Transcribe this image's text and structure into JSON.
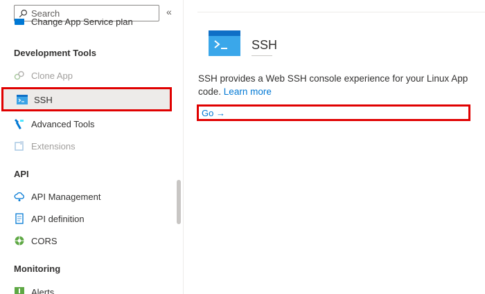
{
  "search": {
    "placeholder": "Search"
  },
  "collapse": {
    "symbol": "«"
  },
  "sidebar": {
    "cut_item": {
      "label": "Change App Service plan",
      "icon": "plan-icon"
    },
    "sections": [
      {
        "title": "Development Tools",
        "items": [
          {
            "label": "Clone App",
            "icon": "clone-icon",
            "disabled": true
          },
          {
            "label": "SSH",
            "icon": "console-icon",
            "selected": true
          },
          {
            "label": "Advanced Tools",
            "icon": "advanced-tools-icon"
          },
          {
            "label": "Extensions",
            "icon": "extensions-icon",
            "disabled": true
          }
        ]
      },
      {
        "title": "API",
        "items": [
          {
            "label": "API Management",
            "icon": "cloud-api-icon"
          },
          {
            "label": "API definition",
            "icon": "document-icon"
          },
          {
            "label": "CORS",
            "icon": "cors-icon"
          }
        ]
      },
      {
        "title": "Monitoring",
        "items": [
          {
            "label": "Alerts",
            "icon": "alert-icon"
          }
        ]
      }
    ]
  },
  "main": {
    "title": "SSH",
    "description": "SSH provides a Web SSH console experience for your Linux App code.",
    "learn_more": "Learn more",
    "go_link": "Go →"
  },
  "colors": {
    "accent": "#0078d4",
    "highlight_border": "#e00000",
    "selected_bg": "#edebe9",
    "disabled_text": "#a19f9d"
  }
}
